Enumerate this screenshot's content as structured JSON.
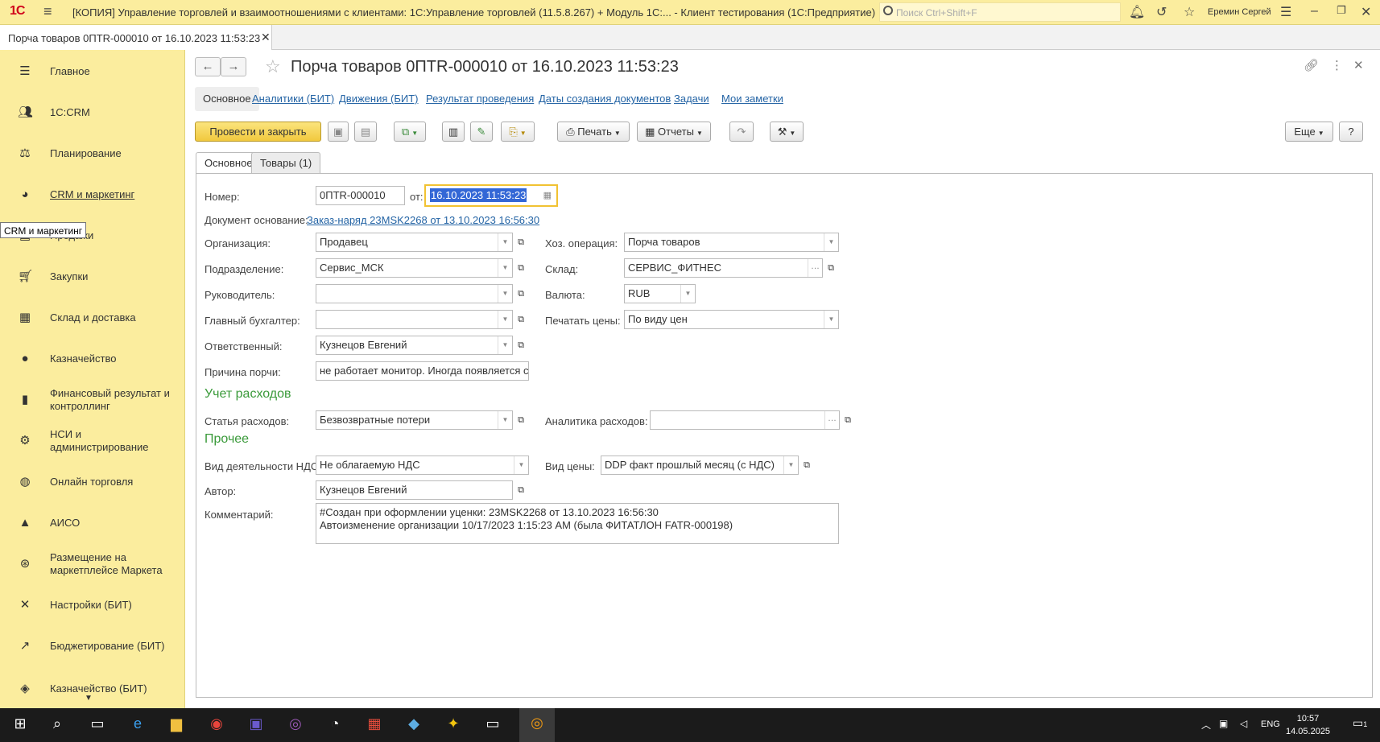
{
  "titlebar": {
    "logo": "1С",
    "title": "[КОПИЯ] Управление торговлей и взаимоотношениями с клиентами: 1С:Управление торговлей (11.5.8.267) + Модуль 1С:...  - Клиент тестирования (1С:Предприятие)",
    "search_placeholder": "Поиск Ctrl+Shift+F",
    "user": "Еремин Сергей"
  },
  "tab": {
    "label": "Порча товаров 0ПТR-000010 от 16.10.2023 11:53:23"
  },
  "sidebar": {
    "items": [
      {
        "label": "Главное",
        "icon": "menu-icon"
      },
      {
        "label": "1С:CRM",
        "icon": "people-icon"
      },
      {
        "label": "Планирование",
        "icon": "planning-icon"
      },
      {
        "label": "CRM и маркетинг",
        "icon": "pie-icon"
      },
      {
        "label": "Продажи",
        "icon": "sales-icon"
      },
      {
        "label": "Закупки",
        "icon": "cart-icon"
      },
      {
        "label": "Склад и доставка",
        "icon": "warehouse-icon"
      },
      {
        "label": "Казначейство",
        "icon": "coin-icon"
      },
      {
        "label": "Финансовый результат и контроллинг",
        "icon": "chart-icon"
      },
      {
        "label": "НСИ и администрирование",
        "icon": "gear-icon"
      },
      {
        "label": "Онлайн торговля",
        "icon": "globe-icon"
      },
      {
        "label": "АИСО",
        "icon": "aiso-icon"
      },
      {
        "label": "Размещение на маркетплейсе Маркета",
        "icon": "market-icon"
      },
      {
        "label": "Настройки (БИТ)",
        "icon": "tools-icon"
      },
      {
        "label": "Бюджетирование (БИТ)",
        "icon": "budget-icon"
      },
      {
        "label": "Казначейство (БИТ)",
        "icon": "treasury-icon"
      }
    ],
    "tooltip": "CRM и маркетинг"
  },
  "document": {
    "title": "Порча товаров 0ПТR-000010 от 16.10.2023 11:53:23",
    "sections": [
      "Основное",
      "Аналитики (БИТ)",
      "Движения (БИТ)",
      "Результат проведения",
      "Даты создания документов",
      "Задачи",
      "Мои заметки"
    ]
  },
  "toolbar": {
    "post_close": "Провести и закрыть",
    "print": "Печать",
    "reports": "Отчеты",
    "more": "Еще",
    "help": "?"
  },
  "inner_tabs": [
    "Основное",
    "Товары (1)"
  ],
  "form": {
    "number_label": "Номер:",
    "number": "0ПТR-000010",
    "from_label": "от:",
    "date": "16.10.2023 11:53:23",
    "base_doc_label": "Документ основание:",
    "base_doc": "Заказ-наряд 23MSK2268 от 13.10.2023 16:56:30",
    "org_label": "Организация:",
    "org": "Продавец",
    "dept_label": "Подразделение:",
    "dept": "Сервис_МСК",
    "head_label": "Руководитель:",
    "head": "",
    "accountant_label": "Главный бухгалтер:",
    "accountant": "",
    "responsible_label": "Ответственный:",
    "responsible": "Кузнецов Евгений",
    "reason_label": "Причина порчи:",
    "reason": "не работает монитор. Иногда появляется стук в",
    "operation_label": "Хоз. операция:",
    "operation": "Порча товаров",
    "warehouse_label": "Склад:",
    "warehouse": "СЕРВИС_ФИТНЕС",
    "currency_label": "Валюта:",
    "currency": "RUB",
    "print_prices_label": "Печатать цены:",
    "print_prices": "По виду цен",
    "expenses_header": "Учет расходов",
    "expense_item_label": "Статья расходов:",
    "expense_item": "Безвозвратные потери",
    "expense_analytics_label": "Аналитика расходов:",
    "expense_analytics": "",
    "other_header": "Прочее",
    "vat_label": "Вид деятельности НДС:",
    "vat": "Не облагаемую НДС",
    "price_type_label": "Вид цены:",
    "price_type": "DDP факт прошлый месяц (с НДС)",
    "author_label": "Автор:",
    "author": "Кузнецов Евгений",
    "comment_label": "Комментарий:",
    "comment_line1": "#Создан при оформлении уценки: 23MSK2268 от 13.10.2023 16:56:30",
    "comment_line2": "Автоизменение организации 10/17/2023 1:15:23 AM (была ФИТАТЛОН  FATR-000198)"
  },
  "taskbar": {
    "lang": "ENG",
    "time": "10:57",
    "date": "14.05.2025",
    "notifications": "1"
  }
}
